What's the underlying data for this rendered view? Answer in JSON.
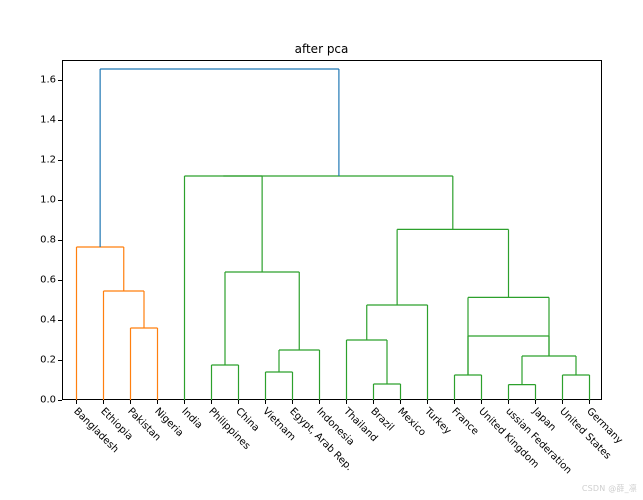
{
  "chart_data": {
    "type": "dendrogram",
    "title": "after pca",
    "xlabel": "",
    "ylabel": "",
    "ylim": [
      0.0,
      1.7
    ],
    "yticks": [
      0.0,
      0.2,
      0.4,
      0.6,
      0.8,
      1.0,
      1.2,
      1.4,
      1.6
    ],
    "leaves": [
      "Bangladesh",
      "Ethiopia",
      "Pakistan",
      "Nigeria",
      "India",
      "Philippines",
      "China",
      "Vietnam",
      "Egypt, Arab Rep.",
      "Indonesia",
      "Thailand",
      "Brazil",
      "Mexico",
      "Turkey",
      "France",
      "United Kingdom",
      "ussian Federation",
      "Japan",
      "United States",
      "Germany"
    ],
    "leaf_x": [
      15,
      45,
      75,
      105,
      135,
      165,
      195,
      225,
      255,
      285,
      315,
      345,
      375,
      405,
      435,
      465,
      495,
      525,
      555,
      585
    ],
    "colors": {
      "orange": "#ff7f0e",
      "green": "#2ca02c",
      "blue": "#1f77b4"
    },
    "links": [
      {
        "left": [
          75,
          0.0
        ],
        "right": [
          105,
          0.0
        ],
        "height": 0.365,
        "color": "orange",
        "mid": 90
      },
      {
        "left": [
          45,
          0.0
        ],
        "right": [
          90,
          0.365
        ],
        "height": 0.55,
        "color": "orange",
        "mid": 67.5
      },
      {
        "left": [
          15,
          0.0
        ],
        "right": [
          67.5,
          0.55
        ],
        "height": 0.77,
        "color": "orange",
        "mid": 41.25
      },
      {
        "left": [
          165,
          0.0
        ],
        "right": [
          195,
          0.0
        ],
        "height": 0.18,
        "color": "green",
        "mid": 180
      },
      {
        "left": [
          225,
          0.0
        ],
        "right": [
          255,
          0.0
        ],
        "height": 0.145,
        "color": "green",
        "mid": 240
      },
      {
        "left": [
          240,
          0.145
        ],
        "right": [
          285,
          0.0
        ],
        "height": 0.255,
        "color": "green",
        "mid": 262.5
      },
      {
        "left": [
          180,
          0.18
        ],
        "right": [
          262.5,
          0.255
        ],
        "height": 0.645,
        "color": "green",
        "mid": 221.25
      },
      {
        "left": [
          135,
          0.0
        ],
        "right": [
          221.25,
          0.645
        ],
        "height": 1.125,
        "color": "green",
        "mid": 178.125
      },
      {
        "left": [
          345,
          0.0
        ],
        "right": [
          375,
          0.0
        ],
        "height": 0.085,
        "color": "green",
        "mid": 360
      },
      {
        "left": [
          315,
          0.0
        ],
        "right": [
          360,
          0.085
        ],
        "height": 0.305,
        "color": "green",
        "mid": 337.5
      },
      {
        "left": [
          337.5,
          0.305
        ],
        "right": [
          405,
          0.0
        ],
        "height": 0.48,
        "color": "green",
        "mid": 371.25
      },
      {
        "left": [
          435,
          0.0
        ],
        "right": [
          465,
          0.0
        ],
        "height": 0.13,
        "color": "green",
        "mid": 450
      },
      {
        "left": [
          495,
          0.0
        ],
        "right": [
          525,
          0.0
        ],
        "height": 0.082,
        "color": "green",
        "mid": 510
      },
      {
        "left": [
          555,
          0.0
        ],
        "right": [
          585,
          0.0
        ],
        "height": 0.13,
        "color": "green",
        "mid": 570
      },
      {
        "left": [
          510,
          0.082
        ],
        "right": [
          570,
          0.13
        ],
        "height": 0.225,
        "color": "green",
        "mid": 540
      },
      {
        "left": [
          540,
          0.225
        ],
        "right": [
          450,
          0.13
        ],
        "height": 0.325,
        "color": "green",
        "mid": 495,
        "swap": true
      },
      {
        "left": [
          450,
          0.13
        ],
        "right": [
          540,
          0.225
        ],
        "height": 0.325,
        "color": "green",
        "mid": 495
      },
      {
        "left": [
          495,
          0.325
        ],
        "right": [
          371.25,
          0.48
        ],
        "height": 0.52,
        "color": "green",
        "mid": 433.125,
        "skip": true
      },
      {
        "left": [
          371.25,
          0.48
        ],
        "right": [
          498.75,
          0.518
        ],
        "height": 0.858,
        "color": "green",
        "mid": 435.0,
        "skip": true
      },
      {
        "left": [
          41.25,
          0.77
        ],
        "right": [
          306.5625,
          1.125
        ],
        "height": 1.66,
        "color": "blue",
        "mid": 173.906,
        "skip": true
      }
    ],
    "explicit_links": [
      {
        "c": "orange",
        "x1": 75,
        "y1": 0.0,
        "x2": 75,
        "y2": 0.365
      },
      {
        "c": "orange",
        "x1": 105,
        "y1": 0.0,
        "x2": 105,
        "y2": 0.365
      },
      {
        "c": "orange",
        "x1": 75,
        "y1": 0.365,
        "x2": 105,
        "y2": 0.365
      },
      {
        "c": "orange",
        "x1": 45,
        "y1": 0.0,
        "x2": 45,
        "y2": 0.55
      },
      {
        "c": "orange",
        "x1": 90,
        "y1": 0.365,
        "x2": 90,
        "y2": 0.55
      },
      {
        "c": "orange",
        "x1": 45,
        "y1": 0.55,
        "x2": 90,
        "y2": 0.55
      },
      {
        "c": "orange",
        "x1": 15,
        "y1": 0.0,
        "x2": 15,
        "y2": 0.77
      },
      {
        "c": "orange",
        "x1": 67.5,
        "y1": 0.55,
        "x2": 67.5,
        "y2": 0.77
      },
      {
        "c": "orange",
        "x1": 15,
        "y1": 0.77,
        "x2": 67.5,
        "y2": 0.77
      },
      {
        "c": "green",
        "x1": 165,
        "y1": 0.0,
        "x2": 165,
        "y2": 0.18
      },
      {
        "c": "green",
        "x1": 195,
        "y1": 0.0,
        "x2": 195,
        "y2": 0.18
      },
      {
        "c": "green",
        "x1": 165,
        "y1": 0.18,
        "x2": 195,
        "y2": 0.18
      },
      {
        "c": "green",
        "x1": 225,
        "y1": 0.0,
        "x2": 225,
        "y2": 0.145
      },
      {
        "c": "green",
        "x1": 255,
        "y1": 0.0,
        "x2": 255,
        "y2": 0.145
      },
      {
        "c": "green",
        "x1": 225,
        "y1": 0.145,
        "x2": 255,
        "y2": 0.145
      },
      {
        "c": "green",
        "x1": 240,
        "y1": 0.145,
        "x2": 240,
        "y2": 0.255
      },
      {
        "c": "green",
        "x1": 285,
        "y1": 0.0,
        "x2": 285,
        "y2": 0.255
      },
      {
        "c": "green",
        "x1": 240,
        "y1": 0.255,
        "x2": 285,
        "y2": 0.255
      },
      {
        "c": "green",
        "x1": 180,
        "y1": 0.18,
        "x2": 180,
        "y2": 0.645
      },
      {
        "c": "green",
        "x1": 262.5,
        "y1": 0.255,
        "x2": 262.5,
        "y2": 0.645
      },
      {
        "c": "green",
        "x1": 180,
        "y1": 0.645,
        "x2": 262.5,
        "y2": 0.645
      },
      {
        "c": "green",
        "x1": 135,
        "y1": 0.0,
        "x2": 135,
        "y2": 1.125
      },
      {
        "c": "green",
        "x1": 221.25,
        "y1": 0.645,
        "x2": 221.25,
        "y2": 1.125
      },
      {
        "c": "green",
        "x1": 135,
        "y1": 1.125,
        "x2": 221.25,
        "y2": 1.125
      },
      {
        "c": "green",
        "x1": 345,
        "y1": 0.0,
        "x2": 345,
        "y2": 0.085
      },
      {
        "c": "green",
        "x1": 375,
        "y1": 0.0,
        "x2": 375,
        "y2": 0.085
      },
      {
        "c": "green",
        "x1": 345,
        "y1": 0.085,
        "x2": 375,
        "y2": 0.085
      },
      {
        "c": "green",
        "x1": 315,
        "y1": 0.0,
        "x2": 315,
        "y2": 0.305
      },
      {
        "c": "green",
        "x1": 360,
        "y1": 0.085,
        "x2": 360,
        "y2": 0.305
      },
      {
        "c": "green",
        "x1": 315,
        "y1": 0.305,
        "x2": 360,
        "y2": 0.305
      },
      {
        "c": "green",
        "x1": 337.5,
        "y1": 0.305,
        "x2": 337.5,
        "y2": 0.48
      },
      {
        "c": "green",
        "x1": 405,
        "y1": 0.0,
        "x2": 405,
        "y2": 0.48
      },
      {
        "c": "green",
        "x1": 337.5,
        "y1": 0.48,
        "x2": 405,
        "y2": 0.48
      },
      {
        "c": "green",
        "x1": 435,
        "y1": 0.0,
        "x2": 435,
        "y2": 0.13
      },
      {
        "c": "green",
        "x1": 465,
        "y1": 0.0,
        "x2": 465,
        "y2": 0.13
      },
      {
        "c": "green",
        "x1": 435,
        "y1": 0.13,
        "x2": 465,
        "y2": 0.13
      },
      {
        "c": "green",
        "x1": 495,
        "y1": 0.0,
        "x2": 495,
        "y2": 0.082
      },
      {
        "c": "green",
        "x1": 525,
        "y1": 0.0,
        "x2": 525,
        "y2": 0.082
      },
      {
        "c": "green",
        "x1": 495,
        "y1": 0.082,
        "x2": 525,
        "y2": 0.082
      },
      {
        "c": "green",
        "x1": 555,
        "y1": 0.0,
        "x2": 555,
        "y2": 0.13
      },
      {
        "c": "green",
        "x1": 585,
        "y1": 0.0,
        "x2": 585,
        "y2": 0.13
      },
      {
        "c": "green",
        "x1": 555,
        "y1": 0.13,
        "x2": 585,
        "y2": 0.13
      },
      {
        "c": "green",
        "x1": 510,
        "y1": 0.082,
        "x2": 510,
        "y2": 0.225
      },
      {
        "c": "green",
        "x1": 570,
        "y1": 0.13,
        "x2": 570,
        "y2": 0.225
      },
      {
        "c": "green",
        "x1": 510,
        "y1": 0.225,
        "x2": 570,
        "y2": 0.225
      },
      {
        "c": "green",
        "x1": 450,
        "y1": 0.13,
        "x2": 450,
        "y2": 0.325
      },
      {
        "c": "green",
        "x1": 540,
        "y1": 0.225,
        "x2": 540,
        "y2": 0.325
      },
      {
        "c": "green",
        "x1": 450,
        "y1": 0.325,
        "x2": 540,
        "y2": 0.325
      },
      {
        "c": "green",
        "x1": 495,
        "y1": 0.325,
        "x2": 495,
        "y2": 0.518
      },
      {
        "c": "green",
        "x1": 371.25,
        "y1": 0.48,
        "x2": 371.25,
        "y2": 0.518
      },
      {
        "c": "green",
        "x1": 371.25,
        "y1": 0.518,
        "x2": 495,
        "y2": 0.518
      },
      {
        "c": "green",
        "x1": 433.125,
        "y1": 0.518,
        "x2": 433.125,
        "y2": 0.858
      },
      {
        "c": "green",
        "x1": 337.5,
        "y1": 0.48,
        "x2": 337.5,
        "y2": 0.48
      },
      {
        "c": "green",
        "x1": 371.25,
        "y1": 0.518,
        "x2": 371.25,
        "y2": 0.518
      },
      {
        "c": "green",
        "x1": 178.125,
        "y1": 1.125,
        "x2": 178.125,
        "y2": 1.125
      },
      {
        "c": "green",
        "x1": 433.125,
        "y1": 0.518,
        "x2": 433.125,
        "y2": 0.858
      },
      {
        "c": "green",
        "x1": 371.25,
        "y1": 0.48,
        "x2": 371.25,
        "y2": 0.48
      },
      {
        "c": "green",
        "x1": 371.25,
        "y1": 0.518,
        "x2": 371.25,
        "y2": 0.858,
        "skip": true
      },
      {
        "c": "green",
        "x1": 178.125,
        "y1": 1.125,
        "x2": 433.125,
        "y2": 1.125,
        "skip": true
      }
    ],
    "top_structure": [
      {
        "c": "green",
        "x1": 371.25,
        "y1": 0.48,
        "x2": 371.25,
        "y2": 0.858
      },
      {
        "c": "green",
        "x1": 495,
        "y1": 0.325,
        "x2": 495,
        "y2": 0.518
      },
      {
        "c": "green",
        "x1": 450,
        "y1": 0.325,
        "x2": 450,
        "y2": 0.518
      },
      {
        "c": "green",
        "x1": 450,
        "y1": 0.518,
        "x2": 540,
        "y2": 0.518,
        "skip": true
      },
      {
        "c": "green",
        "x1": 495,
        "y1": 0.518,
        "x2": 495,
        "y2": 0.858,
        "alt": 498.75
      },
      {
        "c": "green",
        "x1": 371.25,
        "y1": 0.858,
        "x2": 498.75,
        "y2": 0.858
      },
      {
        "c": "green",
        "x1": 178.125,
        "y1": 1.125,
        "x2": 178.125,
        "y2": 1.125
      },
      {
        "c": "green",
        "x1": 435.0,
        "y1": 0.858,
        "x2": 435.0,
        "y2": 1.125
      },
      {
        "c": "green",
        "x1": 178.125,
        "y1": 1.125,
        "x2": 435.0,
        "y2": 1.125
      },
      {
        "c": "blue",
        "x1": 41.25,
        "y1": 0.77,
        "x2": 41.25,
        "y2": 1.66
      },
      {
        "c": "blue",
        "x1": 306.5625,
        "y1": 1.125,
        "x2": 306.5625,
        "y2": 1.66
      },
      {
        "c": "blue",
        "x1": 41.25,
        "y1": 1.66,
        "x2": 306.5625,
        "y2": 1.66
      }
    ]
  },
  "layout": {
    "fig_w": 643,
    "fig_h": 500,
    "ax_left": 62,
    "ax_top": 60,
    "ax_w": 540,
    "ax_h": 340,
    "x_domain": [
      0,
      600
    ]
  },
  "watermark": "CSDN @薛_凛"
}
